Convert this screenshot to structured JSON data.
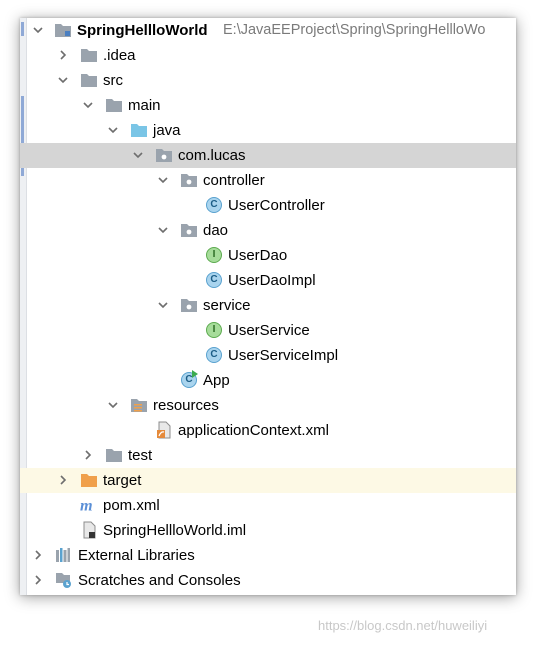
{
  "project_root": {
    "name": "SpringHellloWorld",
    "path": "E:\\JavaEEProject\\Spring\\SpringHellloWo"
  },
  "tree": {
    "idea": ".idea",
    "src": "src",
    "main": "main",
    "java": "java",
    "package": "com.lucas",
    "controller": "controller",
    "user_controller": "UserController",
    "dao": "dao",
    "user_dao": "UserDao",
    "user_dao_impl": "UserDaoImpl",
    "service": "service",
    "user_service": "UserService",
    "user_service_impl": "UserServiceImpl",
    "app": "App",
    "resources": "resources",
    "application_context": "applicationContext.xml",
    "test": "test",
    "target": "target",
    "pom": "pom.xml",
    "iml": "SpringHellloWorld.iml",
    "external_libraries": "External Libraries",
    "scratches": "Scratches and Consoles"
  },
  "icon_letters": {
    "class": "C",
    "interface": "I"
  },
  "colors": {
    "selected_row": "#d5d5d5",
    "excluded_row": "#fdf9e5",
    "folder_gray": "#9aa3ad",
    "folder_blue": "#7ac5e6",
    "folder_orange": "#f0a04b",
    "class_icon": "#a9d4ee",
    "interface_icon": "#a6dc9a",
    "maven_m": "#5b8fd6"
  },
  "watermark": "https://blog.csdn.net/huweiliyi"
}
